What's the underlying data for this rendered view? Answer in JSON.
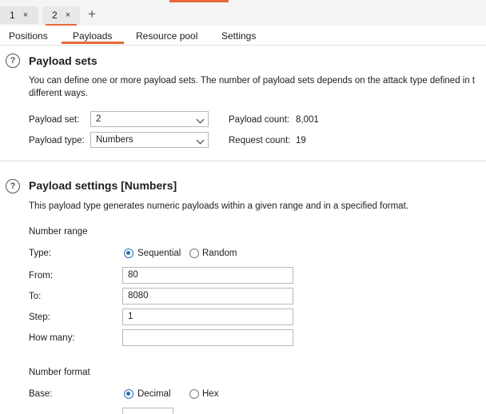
{
  "request_tabs": [
    {
      "label": "1",
      "close": "×",
      "active": false
    },
    {
      "label": "2",
      "close": "×",
      "active": true
    }
  ],
  "add_tab_label": "+",
  "subtabs": [
    "Positions",
    "Payloads",
    "Resource pool",
    "Settings"
  ],
  "active_subtab": "Payloads",
  "help_glyph": "?",
  "payload_sets": {
    "title": "Payload sets",
    "desc_line1": "You can define one or more payload sets. The number of payload sets depends on the attack type defined in t",
    "desc_line2": "different ways.",
    "set_label": "Payload set:",
    "set_value": "2",
    "type_label": "Payload type:",
    "type_value": "Numbers",
    "count_label": "Payload count:",
    "count_value": "8,001",
    "request_label": "Request count:",
    "request_value": "19"
  },
  "payload_settings": {
    "title": "Payload settings [Numbers]",
    "desc": "This payload type generates numeric payloads within a given range and in a specified format.",
    "range_heading": "Number range",
    "type_label": "Type:",
    "type_options": [
      "Sequential",
      "Random"
    ],
    "type_selected": "Sequential",
    "from_label": "From:",
    "from_value": "80",
    "to_label": "To:",
    "to_value": "8080",
    "step_label": "Step:",
    "step_value": "1",
    "howmany_label": "How many:",
    "howmany_value": "",
    "format_heading": "Number format",
    "base_label": "Base:",
    "base_options": [
      "Decimal",
      "Hex"
    ],
    "base_selected": "Decimal"
  },
  "colors": {
    "accent": "#e8683a",
    "radio": "#2b6fb6"
  }
}
